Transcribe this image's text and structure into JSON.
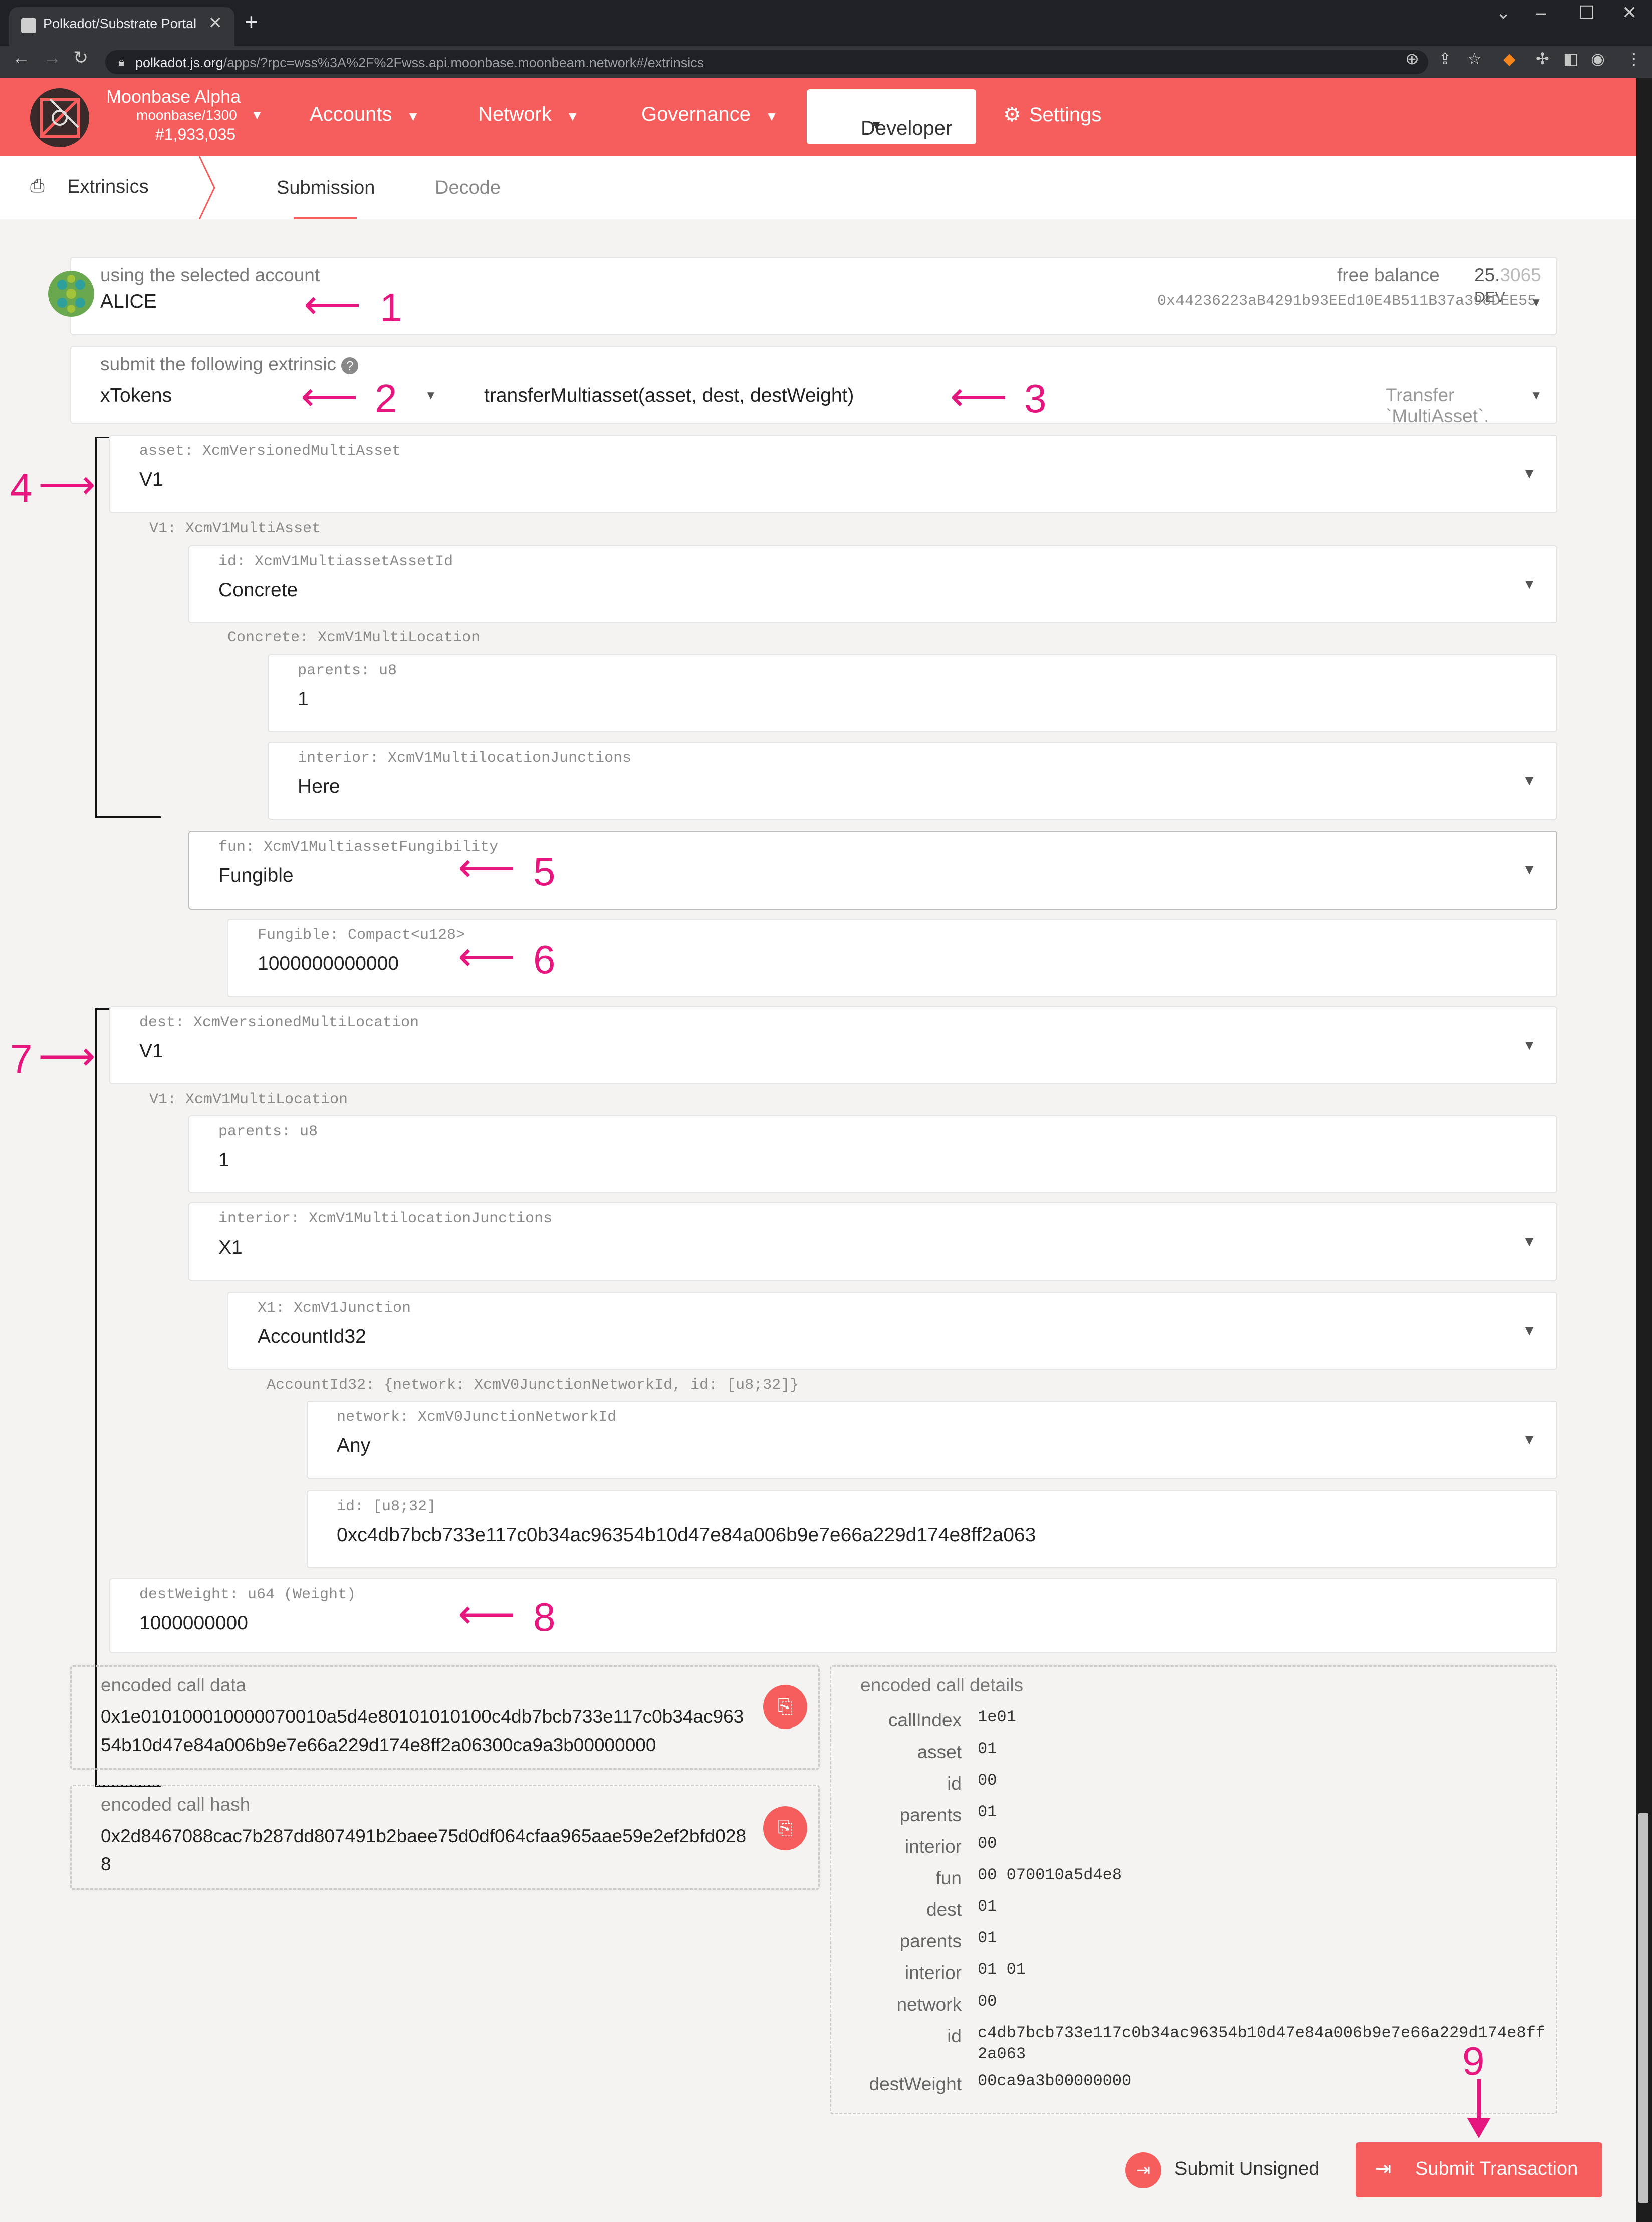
{
  "browser": {
    "tab_title": "Polkadot/Substrate Portal",
    "url_host": "polkadot.js.org",
    "url_rest": "/apps/?rpc=wss%3A%2F%2Fwss.api.moonbase.moonbeam.network#/extrinsics"
  },
  "header": {
    "chain_name": "Moonbase Alpha",
    "chain_runtime": "moonbase/1300",
    "block": "#1,933,035",
    "menu": [
      "Accounts",
      "Network",
      "Governance",
      "Developer",
      "Settings"
    ]
  },
  "subnav": {
    "section": "Extrinsics",
    "tabs": [
      "Submission",
      "Decode"
    ]
  },
  "account": {
    "label": "using the selected account",
    "name": "ALICE",
    "balance_label": "free balance",
    "balance_main": "25.",
    "balance_frac": "3065",
    "balance_unit": "DEV",
    "address": "0x44236223aB4291b93EEd10E4B511B37a398DEE55"
  },
  "extrinsic": {
    "label": "submit the following extrinsic",
    "pallet": "xTokens",
    "call": "transferMultiasset(asset, dest, destWeight)",
    "doc": "Transfer `MultiAsset`."
  },
  "fields": {
    "asset_label": "asset: XcmVersionedMultiAsset",
    "asset_value": "V1",
    "v1_asset_label": "V1: XcmV1MultiAsset",
    "id_label": "id: XcmV1MultiassetAssetId",
    "id_value": "Concrete",
    "concrete_label": "Concrete: XcmV1MultiLocation",
    "parents_label": "parents: u8",
    "parents_value": "1",
    "interior_label": "interior: XcmV1MultilocationJunctions",
    "interior_value": "Here",
    "fun_label": "fun: XcmV1MultiassetFungibility",
    "fun_value": "Fungible",
    "fungible_label": "Fungible: Compact<u128>",
    "fungible_value": "1000000000000",
    "dest_label": "dest: XcmVersionedMultiLocation",
    "dest_value": "V1",
    "v1_dest_label": "V1: XcmV1MultiLocation",
    "dest_parents_label": "parents: u8",
    "dest_parents_value": "1",
    "dest_interior_label": "interior: XcmV1MultilocationJunctions",
    "dest_interior_value": "X1",
    "x1_label": "X1: XcmV1Junction",
    "x1_value": "AccountId32",
    "accountid32_label": "AccountId32: {network: XcmV0JunctionNetworkId, id: [u8;32]}",
    "network_label": "network: XcmV0JunctionNetworkId",
    "network_value": "Any",
    "idbytes_label": "id: [u8;32]",
    "idbytes_value": "0xc4db7bcb733e117c0b34ac96354b10d47e84a006b9e7e66a229d174e8ff2a063",
    "destweight_label": "destWeight: u64 (Weight)",
    "destweight_value": "1000000000"
  },
  "encoded": {
    "call_data_label": "encoded call data",
    "call_data": "0x1e010100010000070010a5d4e80101010100c4db7bcb733e117c0b34ac963\n54b10d47e84a006b9e7e66a229d174e8ff2a06300ca9a3b00000000",
    "call_hash_label": "encoded call hash",
    "call_hash": "0x2d8467088cac7b287dd807491b2baee75d0df064cfaa965aae59e2ef2bfd028\n8",
    "details_label": "encoded call details",
    "details": [
      {
        "k": "callIndex",
        "v": "1e01"
      },
      {
        "k": "asset",
        "v": "01"
      },
      {
        "k": "id",
        "v": "00"
      },
      {
        "k": "parents",
        "v": "01"
      },
      {
        "k": "interior",
        "v": "00"
      },
      {
        "k": "fun",
        "v": "00 070010a5d4e8"
      },
      {
        "k": "dest",
        "v": "01"
      },
      {
        "k": "parents",
        "v": "01"
      },
      {
        "k": "interior",
        "v": "01 01"
      },
      {
        "k": "network",
        "v": "00"
      },
      {
        "k": "id",
        "v": "c4db7bcb733e117c0b34ac96354b10d47e84a006b9e7e66a229d174e8ff\n2a063"
      },
      {
        "k": "destWeight",
        "v": "00ca9a3b00000000"
      }
    ]
  },
  "actions": {
    "unsigned": "Submit Unsigned",
    "transaction": "Submit Transaction"
  },
  "annotations": [
    "1",
    "2",
    "3",
    "4",
    "5",
    "6",
    "7",
    "8",
    "9"
  ],
  "colors": {
    "accent": "#f55e5c",
    "annotation": "#e5177e",
    "background": "#f4f3f1"
  }
}
